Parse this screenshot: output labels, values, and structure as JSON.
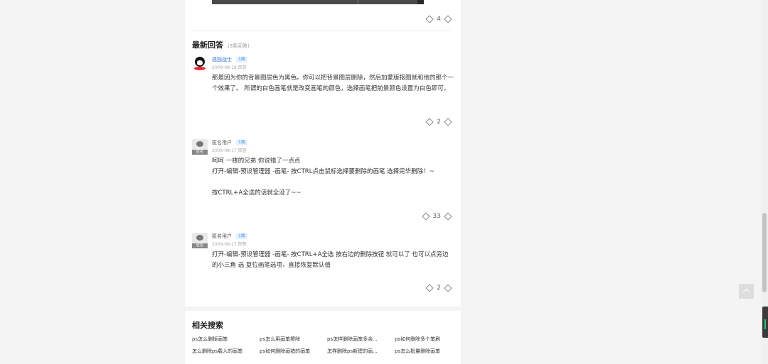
{
  "answers_section": {
    "title": "最新回答",
    "count": "(3条回答)"
  },
  "top_votes": "4",
  "answers": [
    {
      "user": "孤独战士",
      "level": "1级",
      "date": "2009-08-18 回答",
      "avatar_icon": "qq-penguin-avatar",
      "lines": [
        "那是因为你的背景图层色为黑色。你可以把背景图层删除，然后加蒙版抠图就和他的那个一个效果了。 所谓的白色画笔就是改变画笔的颜色，选择画笔把前景颜色设置为白色即可。"
      ],
      "votes": "2"
    },
    {
      "user": "匿名用户",
      "level": "1级",
      "date": "2009-08-17 回答",
      "avatar_icon": "anonymous-avatar",
      "avatar_label": "匿名",
      "lines": [
        "呵呵 一楼的兄弟 你说错了一点点",
        "打开-编辑-预设管理器 -画笔- 按CTRL点击鼠标选择要删除的画笔 选择完毕删除！~",
        "",
        "按CTRL+A全选的话就全没了~~"
      ],
      "votes": "33"
    },
    {
      "user": "匿名用户",
      "level": "1级",
      "date": "2009-08-17 回答",
      "avatar_icon": "anonymous-avatar",
      "avatar_label": "匿名",
      "lines": [
        "打开-编辑-预设管理器 -画笔- 按CTRL+A全选 按右边的删除按钮 就可以了 也可以点旁边的小三角 选 复位画笔选项，直接恢复默认值"
      ],
      "votes": "2"
    }
  ],
  "related": {
    "title": "相关搜索",
    "links": [
      "ps怎么删掉画笔",
      "ps怎么用画笔擦除",
      "ps怎样删除画笔多余...",
      "ps如何删除多个笔刷",
      "怎么删除ps载入的画笔",
      "ps如何删除画错的画笔",
      "怎样删除ps新建的画...",
      "ps怎么批量删除画笔"
    ]
  },
  "icons": {
    "vote_up": "vote-up-icon",
    "vote_down": "vote-down-icon",
    "back_to_top": "back-to-top-icon"
  },
  "colors": {
    "username_link": "#2f6fd6",
    "level_badge": "#3a8ee6",
    "page_bg": "#f4f4f4"
  }
}
